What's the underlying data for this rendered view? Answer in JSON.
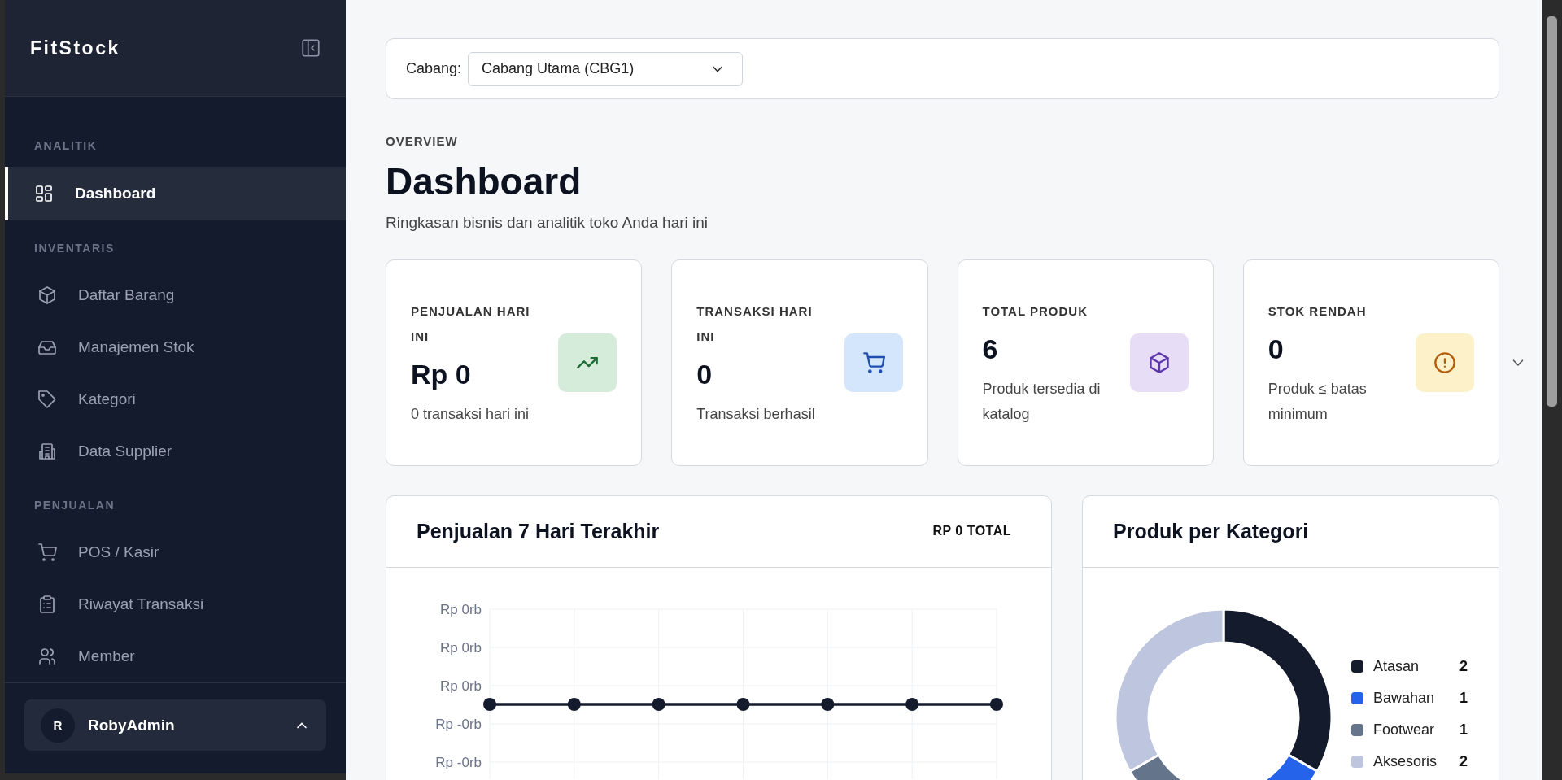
{
  "sidebar": {
    "brand": "FitStock",
    "sections": [
      {
        "title": "ANALITIK",
        "items": [
          {
            "label": "Dashboard",
            "kind": "grid",
            "selected": true
          }
        ]
      },
      {
        "title": "INVENTARIS",
        "items": [
          {
            "label": "Daftar Barang",
            "kind": "box",
            "selected": false
          },
          {
            "label": "Manajemen Stok",
            "kind": "inbox",
            "selected": false
          },
          {
            "label": "Kategori",
            "kind": "tag",
            "selected": false
          },
          {
            "label": "Data Supplier",
            "kind": "building",
            "selected": false
          }
        ]
      },
      {
        "title": "PENJUALAN",
        "items": [
          {
            "label": "POS / Kasir",
            "kind": "cart",
            "selected": false
          },
          {
            "label": "Riwayat Transaksi",
            "kind": "clipboard",
            "selected": false
          },
          {
            "label": "Member",
            "kind": "users",
            "selected": false
          }
        ]
      }
    ],
    "user": {
      "initial": "R",
      "name": "RobyAdmin"
    }
  },
  "branch": {
    "label": "Cabang:",
    "value": "Cabang Utama (CBG1)"
  },
  "header": {
    "eyebrow": "OVERVIEW",
    "title": "Dashboard",
    "subtitle": "Ringkasan bisnis dan analitik toko Anda hari ini"
  },
  "stats": [
    {
      "label": "PENJUALAN HARI INI",
      "value": "Rp 0",
      "note": "0 transaksi hari ini",
      "kind": "trend"
    },
    {
      "label": "TRANSAKSI HARI INI",
      "value": "0",
      "note": "Transaksi berhasil",
      "kind": "cart"
    },
    {
      "label": "TOTAL PRODUK",
      "value": "6",
      "note": "Produk tersedia di katalog",
      "kind": "box"
    },
    {
      "label": "STOK RENDAH",
      "value": "0",
      "note": "Produk ≤ batas minimum",
      "kind": "alert"
    }
  ],
  "sales_chart": {
    "title": "Penjualan 7 Hari Terakhir",
    "total": "RP 0 TOTAL",
    "y_labels": [
      "Rp 0rb",
      "Rp 0rb",
      "Rp 0rb",
      "Rp -0rb",
      "Rp -0rb"
    ]
  },
  "category_chart": {
    "title": "Produk per Kategori",
    "chart_data": {
      "type": "donut",
      "categories": [
        "Atasan",
        "Bawahan",
        "Footwear",
        "Aksesoris"
      ],
      "series": [
        {
          "values": [
            2,
            1,
            1,
            2
          ]
        }
      ],
      "legend": "right",
      "data_labels": true
    },
    "slices": [
      {
        "color": "#141b2d"
      },
      {
        "color": "#2563eb"
      },
      {
        "color": "#64748b"
      },
      {
        "color": "#bec5de"
      }
    ]
  }
}
